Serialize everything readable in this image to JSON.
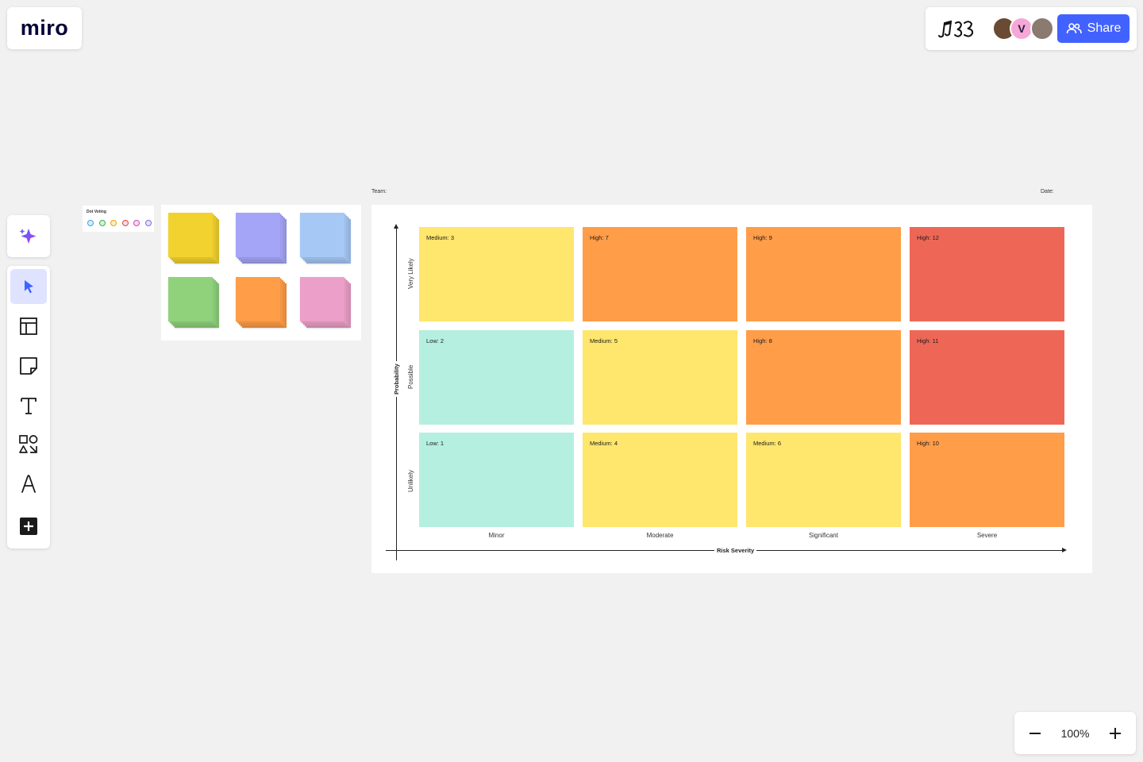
{
  "app": {
    "logo": "miro",
    "share_label": "Share",
    "collaborators": [
      {
        "initial": "",
        "color": "#6a4a33"
      },
      {
        "initial": "V",
        "color": "#f5a8d8"
      },
      {
        "initial": "",
        "color": "#8a7a70"
      }
    ]
  },
  "toolbar": {
    "tools": [
      {
        "name": "select",
        "icon": "cursor-icon",
        "active": true
      },
      {
        "name": "templates",
        "icon": "layout-icon"
      },
      {
        "name": "sticky-note",
        "icon": "sticky-note-icon"
      },
      {
        "name": "text",
        "icon": "text-icon"
      },
      {
        "name": "shapes",
        "icon": "shapes-icon"
      },
      {
        "name": "pen",
        "icon": "pen-icon"
      },
      {
        "name": "more",
        "icon": "plus-square-icon"
      }
    ]
  },
  "zoom": {
    "value": "100%"
  },
  "dot_voting": {
    "title": "Dot Voting",
    "dot_colors": [
      "#3ca3e0",
      "#39b54a",
      "#e6a700",
      "#e0454b",
      "#d04ab0",
      "#7b68ee"
    ]
  },
  "stickies": {
    "colors": [
      "#f2d22f",
      "#a5a5f7",
      "#a6c8f5",
      "#8fd27b",
      "#ff9d48",
      "#ec9fc8"
    ]
  },
  "matrix": {
    "team_label": "Team:",
    "date_label": "Date:",
    "x_axis_title": "Risk Severity",
    "y_axis_title": "Probability",
    "columns": [
      "Minor",
      "Moderate",
      "Significant",
      "Severe"
    ],
    "rows": [
      "Very Likely",
      "Possible",
      "Unlikely"
    ],
    "cells": [
      [
        {
          "label": "Medium: 3",
          "color": "#ffe66d"
        },
        {
          "label": "High: 7",
          "color": "#ff9d48"
        },
        {
          "label": "High: 9",
          "color": "#ff9d48"
        },
        {
          "label": "High: 12",
          "color": "#ee6756"
        }
      ],
      [
        {
          "label": "Low: 2",
          "color": "#b5efdf"
        },
        {
          "label": "Medium: 5",
          "color": "#ffe66d"
        },
        {
          "label": "High: 8",
          "color": "#ff9d48"
        },
        {
          "label": "High: 11",
          "color": "#ee6756"
        }
      ],
      [
        {
          "label": "Low: 1",
          "color": "#b5efdf"
        },
        {
          "label": "Medium: 4",
          "color": "#ffe66d"
        },
        {
          "label": "Medium: 6",
          "color": "#ffe66d"
        },
        {
          "label": "High: 10",
          "color": "#ff9d48"
        }
      ]
    ]
  }
}
